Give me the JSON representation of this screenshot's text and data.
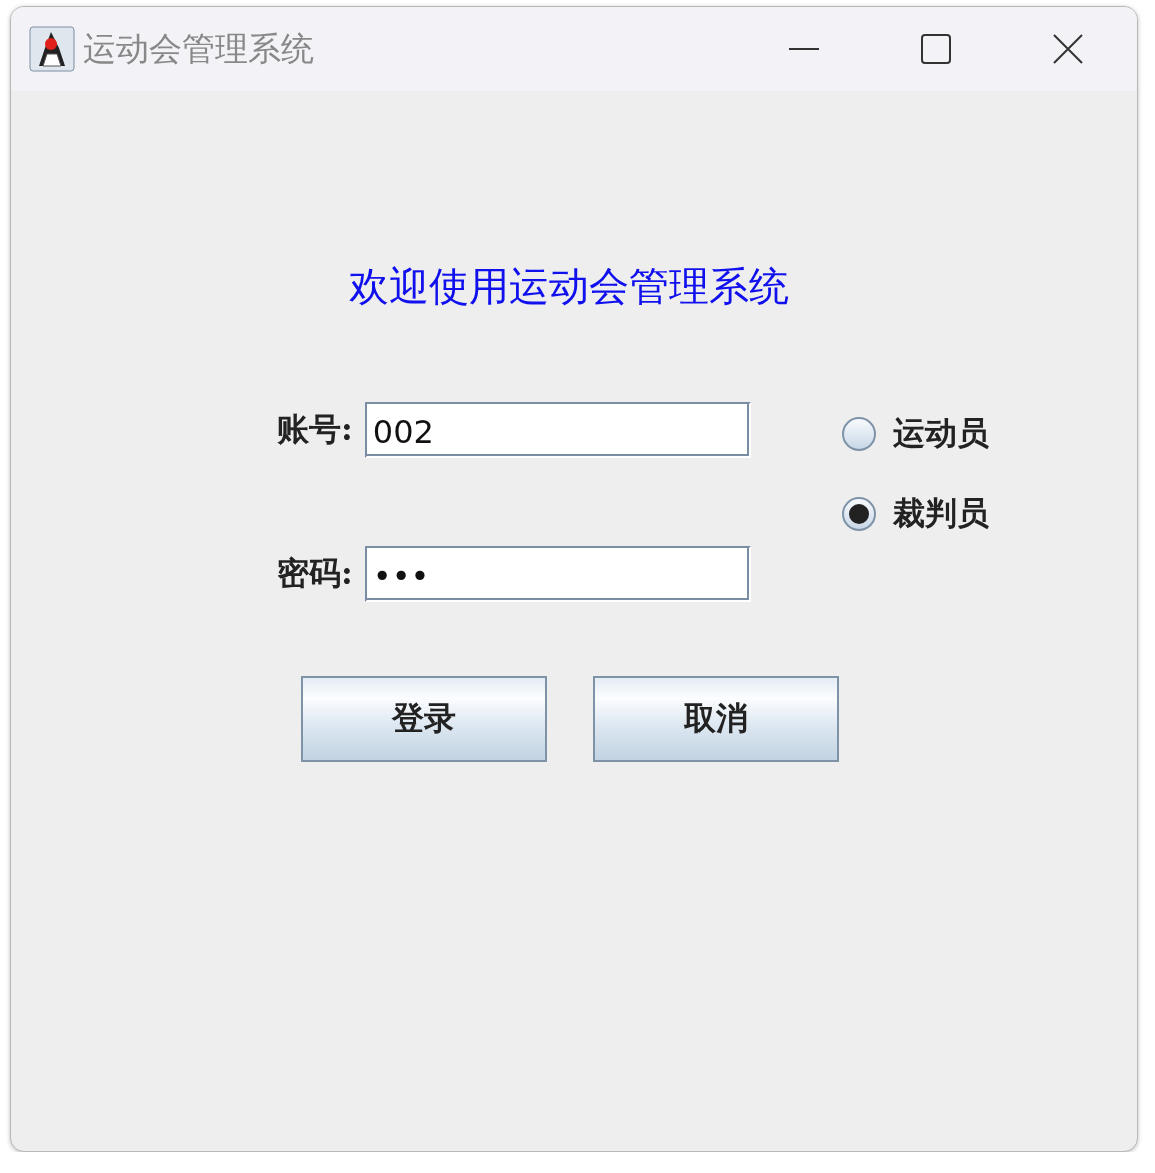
{
  "window": {
    "title": "运动会管理系统"
  },
  "heading": "欢迎使用运动会管理系统",
  "fields": [
    {
      "label": "账号:",
      "value": "002"
    },
    {
      "label": "密码:",
      "value": "•••"
    }
  ],
  "roles": [
    {
      "label": "运动员",
      "selected": false
    },
    {
      "label": "裁判员",
      "selected": true
    }
  ],
  "buttons": [
    "登录",
    "取消"
  ]
}
